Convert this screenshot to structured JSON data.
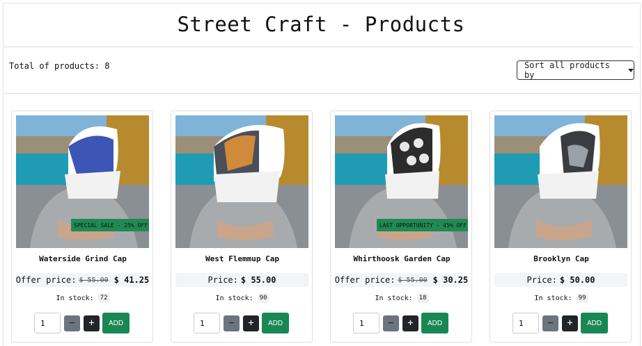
{
  "header": {
    "title": "Street Craft - Products"
  },
  "toolbar": {
    "total_text": "Total of products: 8",
    "sort_label": "Sort all products by"
  },
  "products": [
    {
      "name": "Waterside Grind Cap",
      "badge": "SPECIAL SALE - 25% OFF",
      "price_label": "Offer price:",
      "old_price": "$ 55.00",
      "price": "$ 41.25",
      "stock_label": "In stock:",
      "stock": "72",
      "qty": "1",
      "add_label": "ADD",
      "minus": "−",
      "plus": "+"
    },
    {
      "name": "West Flemmup Cap",
      "badge": "",
      "price_label": "Price:",
      "old_price": "",
      "price": "$ 55.00",
      "stock_label": "In stock:",
      "stock": "90",
      "qty": "1",
      "add_label": "ADD",
      "minus": "−",
      "plus": "+"
    },
    {
      "name": "Whirthoosk Garden Cap",
      "badge": "LAST OPPORTUNITY - 45% OFF",
      "price_label": "Offer price:",
      "old_price": "$ 55.00",
      "price": "$ 30.25",
      "stock_label": "In stock:",
      "stock": "18",
      "qty": "1",
      "add_label": "ADD",
      "minus": "−",
      "plus": "+"
    },
    {
      "name": "Brooklyn Cap",
      "badge": "",
      "price_label": "Price:",
      "old_price": "",
      "price": "$ 50.00",
      "stock_label": "In stock:",
      "stock": "99",
      "qty": "1",
      "add_label": "ADD",
      "minus": "−",
      "plus": "+"
    }
  ],
  "colors": {
    "add_button": "#198754",
    "badge": "#1f8a52",
    "minus_button": "#6c757d",
    "plus_button": "#212529"
  },
  "icons": {
    "sort_caret": "caret-down-icon"
  }
}
